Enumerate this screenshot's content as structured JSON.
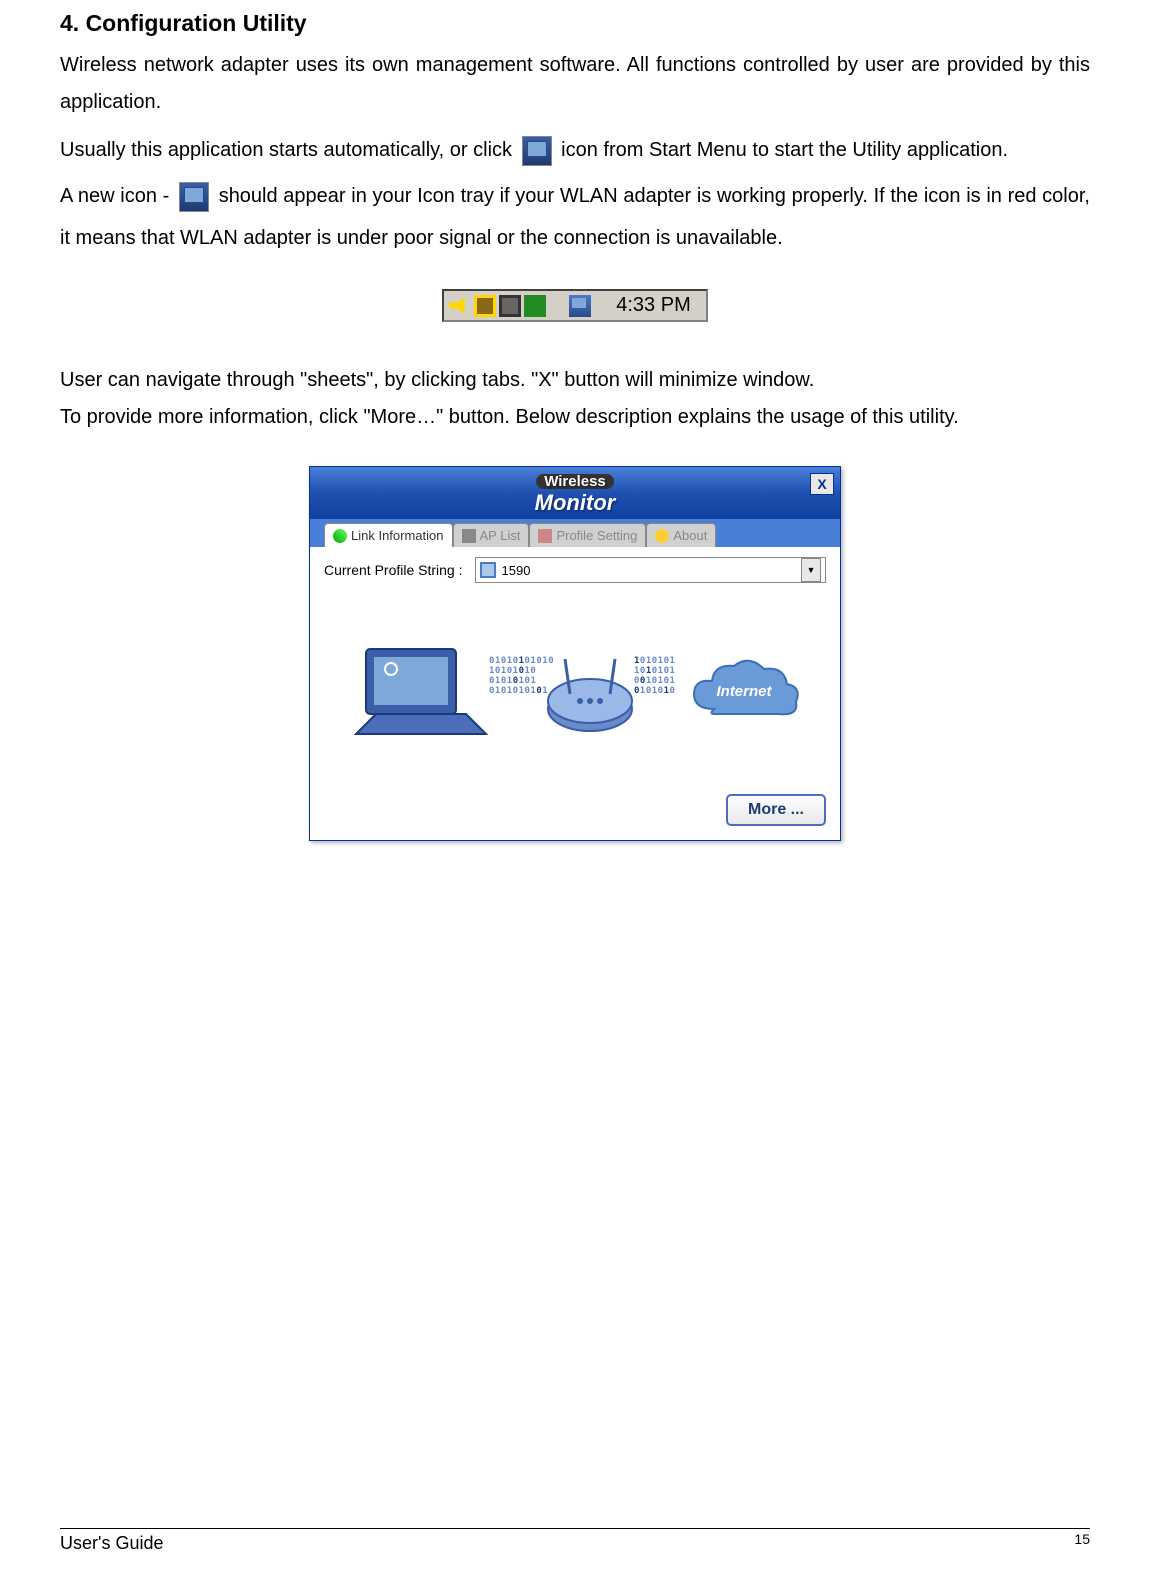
{
  "section": {
    "title": "4. Configuration Utility"
  },
  "paragraphs": {
    "p1": "Wireless network adapter uses its own management software. All functions controlled by user are provided by this application.",
    "p2a": "Usually this application starts automatically, or click ",
    "p2b": " icon from Start Menu to start the Utility application.",
    "p3a": "A new icon - ",
    "p3b": " should appear in your Icon tray if your WLAN adapter is working properly. If the icon is in red color, it means that WLAN adapter is under poor signal or the connection is unavailable.",
    "p4": "User can navigate through \"sheets\", by clicking tabs.  \"X\" button will minimize window.",
    "p5": "To provide more information, click \"More…\" button. Below description explains the usage of this utility."
  },
  "systray": {
    "time": "4:33 PM"
  },
  "monitor": {
    "title_top": "Wireless",
    "title_main": "Monitor",
    "close": "X",
    "tabs": {
      "link": "Link Information",
      "ap": "AP List",
      "profile": "Profile Setting",
      "about": "About"
    },
    "profile": {
      "label": "Current Profile String :",
      "value": "1590"
    },
    "internet_label": "Internet",
    "more_button": "More ..."
  },
  "footer": {
    "guide": "User's Guide",
    "page": "15"
  }
}
